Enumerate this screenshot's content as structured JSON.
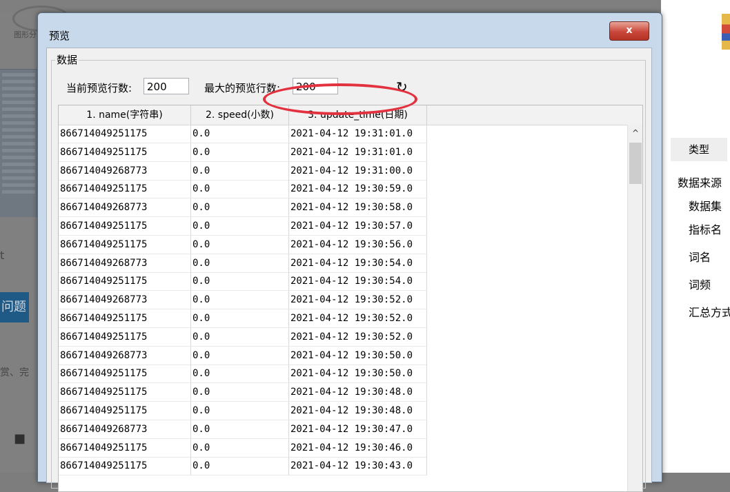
{
  "background_app": {
    "left_icon_label": "图形分",
    "left_text_t": "t",
    "left_button_label": "问题",
    "left_text_bottom": "赏、完",
    "right_tab_label": "类型",
    "right_items": [
      "数据来源",
      "数据集",
      "指标名",
      "词名",
      "词频",
      "汇总方式"
    ]
  },
  "dialog": {
    "title": "预览",
    "close_label": "x",
    "group_label": "数据",
    "current_rows_label": "当前预览行数:",
    "current_rows_value": "200",
    "max_rows_label": "最大的预览行数:",
    "max_rows_value": "200",
    "refresh_icon": "refresh-icon"
  },
  "table": {
    "columns": [
      "1. name(字符串)",
      "2. speed(小数)",
      "3. update_time(日期)"
    ],
    "rows": [
      [
        "866714049251175",
        "0.0",
        "2021-04-12 19:31:01.0"
      ],
      [
        "866714049251175",
        "0.0",
        "2021-04-12 19:31:01.0"
      ],
      [
        "866714049268773",
        "0.0",
        "2021-04-12 19:31:00.0"
      ],
      [
        "866714049251175",
        "0.0",
        "2021-04-12 19:30:59.0"
      ],
      [
        "866714049268773",
        "0.0",
        "2021-04-12 19:30:58.0"
      ],
      [
        "866714049251175",
        "0.0",
        "2021-04-12 19:30:57.0"
      ],
      [
        "866714049251175",
        "0.0",
        "2021-04-12 19:30:56.0"
      ],
      [
        "866714049268773",
        "0.0",
        "2021-04-12 19:30:54.0"
      ],
      [
        "866714049251175",
        "0.0",
        "2021-04-12 19:30:54.0"
      ],
      [
        "866714049268773",
        "0.0",
        "2021-04-12 19:30:52.0"
      ],
      [
        "866714049251175",
        "0.0",
        "2021-04-12 19:30:52.0"
      ],
      [
        "866714049251175",
        "0.0",
        "2021-04-12 19:30:52.0"
      ],
      [
        "866714049268773",
        "0.0",
        "2021-04-12 19:30:50.0"
      ],
      [
        "866714049251175",
        "0.0",
        "2021-04-12 19:30:50.0"
      ],
      [
        "866714049251175",
        "0.0",
        "2021-04-12 19:30:48.0"
      ],
      [
        "866714049251175",
        "0.0",
        "2021-04-12 19:30:48.0"
      ],
      [
        "866714049268773",
        "0.0",
        "2021-04-12 19:30:47.0"
      ],
      [
        "866714049251175",
        "0.0",
        "2021-04-12 19:30:46.0"
      ],
      [
        "866714049251175",
        "0.0",
        "2021-04-12 19:30:43.0"
      ]
    ]
  },
  "colors": {
    "highlight": "#e2323f",
    "dialog_frame": "#c8d9ec",
    "close_button": "#c9473a"
  }
}
